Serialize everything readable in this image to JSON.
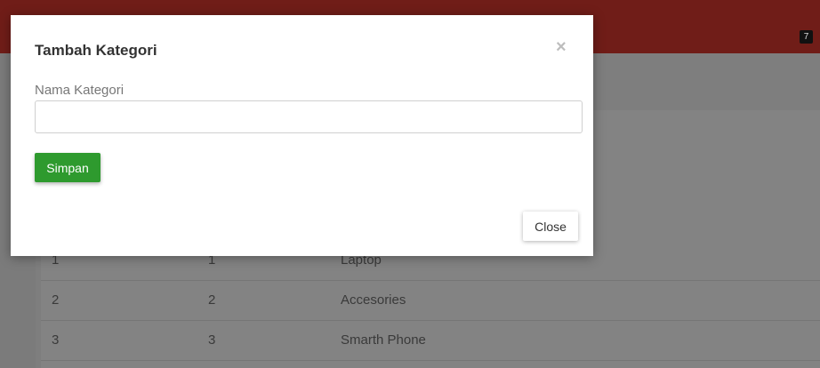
{
  "header": {
    "badge_count": "7",
    "bar_color": "#701d18"
  },
  "table": {
    "rows": [
      {
        "no": "1",
        "id": "1",
        "name": "Laptop"
      },
      {
        "no": "2",
        "id": "2",
        "name": "Accesories"
      },
      {
        "no": "3",
        "id": "3",
        "name": "Smarth Phone"
      }
    ]
  },
  "modal": {
    "title": "Tambah Kategori",
    "close_x": "×",
    "field_label": "Nama Kategori",
    "field_value": "",
    "save_label": "Simpan",
    "close_label": "Close",
    "save_color": "#2e9a2e"
  }
}
